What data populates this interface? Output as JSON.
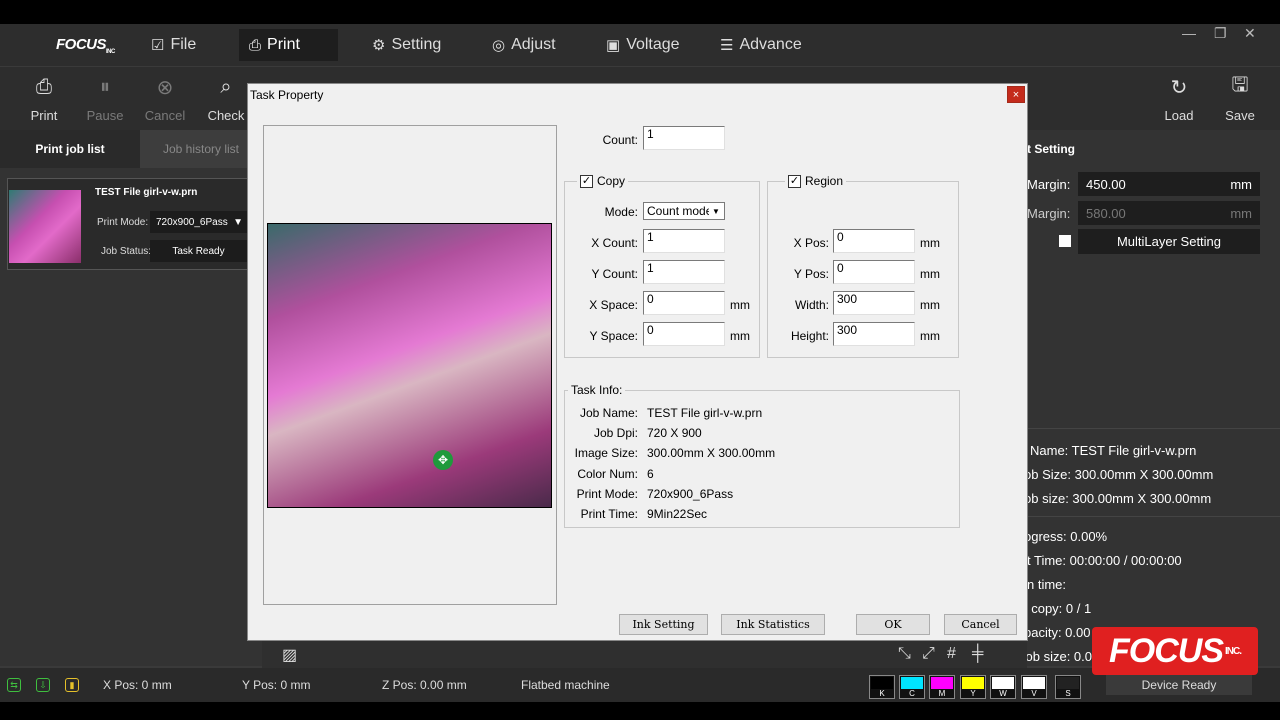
{
  "app": {
    "logo": "FOCUS",
    "logo_sub": "INC"
  },
  "menu": {
    "items": [
      {
        "label": "File",
        "icon": "file-icon"
      },
      {
        "label": "Print",
        "icon": "print-icon"
      },
      {
        "label": "Setting",
        "icon": "gear-icon"
      },
      {
        "label": "Adjust",
        "icon": "adjust-icon"
      },
      {
        "label": "Voltage",
        "icon": "voltage-icon"
      },
      {
        "label": "Advance",
        "icon": "advance-icon"
      }
    ],
    "active": "Print"
  },
  "toolbar": {
    "left": [
      {
        "label": "Print",
        "enabled": true
      },
      {
        "label": "Pause",
        "enabled": false
      },
      {
        "label": "Cancel",
        "enabled": false
      },
      {
        "label": "Check",
        "enabled": true
      }
    ],
    "right": [
      {
        "label": "Load"
      },
      {
        "label": "Save"
      }
    ]
  },
  "left_panel": {
    "tabs": [
      "Print job list",
      "Job history list"
    ],
    "job": {
      "title": "TEST File girl-v-w.prn",
      "print_mode_label": "Print Mode:",
      "print_mode_value": "720x900_6Pass",
      "job_status_label": "Job Status:",
      "job_status_value": "Task Ready"
    }
  },
  "right_panel": {
    "heading": "t Setting",
    "margin1_label": "Margin:",
    "margin1_value": "450.00",
    "margin1_unit": "mm",
    "margin2_label": "Margin:",
    "margin2_value": "580.00",
    "margin2_unit": "mm",
    "multilayer": "MultiLayer Setting",
    "info": [
      "Name: TEST File girl-v-w.prn",
      "ob Size: 300.00mm X 300.00mm",
      "ob size: 300.00mm X 300.00mm"
    ],
    "progress": "ogress: 0.00%",
    "time": "t Time: 00:00:00 / 00:00:00",
    "run_time": "n time:",
    "copy": "t copy: 0 / 1",
    "capacity": "pacity: 0.00",
    "job_size": "Job size: 0.00"
  },
  "dialog": {
    "title": "Task Property",
    "close": "×",
    "count_label": "Count:",
    "count_value": "1",
    "copy": {
      "title": "Copy",
      "checked": true,
      "mode_label": "Mode:",
      "mode_value": "Count mode",
      "x_count_label": "X Count:",
      "x_count_value": "1",
      "y_count_label": "Y Count:",
      "y_count_value": "1",
      "x_space_label": "X Space:",
      "x_space_value": "0",
      "y_space_label": "Y Space:",
      "y_space_value": "0",
      "unit": "mm"
    },
    "region": {
      "title": "Region",
      "checked": true,
      "x_pos_label": "X Pos:",
      "x_pos_value": "0",
      "y_pos_label": "Y Pos:",
      "y_pos_value": "0",
      "width_label": "Width:",
      "width_value": "300",
      "height_label": "Height:",
      "height_value": "300",
      "unit": "mm"
    },
    "task_info": {
      "title": "Task Info:",
      "rows": [
        {
          "label": "Job Name:",
          "value": "TEST File girl-v-w.prn"
        },
        {
          "label": "Job Dpi:",
          "value": "720 X 900"
        },
        {
          "label": "Image Size:",
          "value": "300.00mm X 300.00mm"
        },
        {
          "label": "Color Num:",
          "value": "6"
        },
        {
          "label": "Print Mode:",
          "value": "720x900_6Pass"
        },
        {
          "label": "Print Time:",
          "value": "9Min22Sec"
        }
      ]
    },
    "buttons": {
      "ink_setting": "Ink Setting",
      "ink_statistics": "Ink Statistics",
      "ok": "OK",
      "cancel": "Cancel"
    }
  },
  "status_bar": {
    "x_pos": "X Pos: 0 mm",
    "y_pos": "Y Pos: 0 mm",
    "z_pos": "Z Pos: 0.00 mm",
    "machine": "Flatbed machine",
    "inks": [
      {
        "label": "K",
        "color": "#000000"
      },
      {
        "label": "C",
        "color": "#00e5ff"
      },
      {
        "label": "M",
        "color": "#ff00ff"
      },
      {
        "label": "Y",
        "color": "#ffff00"
      },
      {
        "label": "W",
        "color": "#ffffff"
      },
      {
        "label": "V",
        "color": "#ffffff"
      },
      {
        "label": "S",
        "color": "#222222"
      }
    ],
    "device_status": "Device Ready"
  },
  "watermark": {
    "text": "FOCUS",
    "sub": "INC."
  }
}
